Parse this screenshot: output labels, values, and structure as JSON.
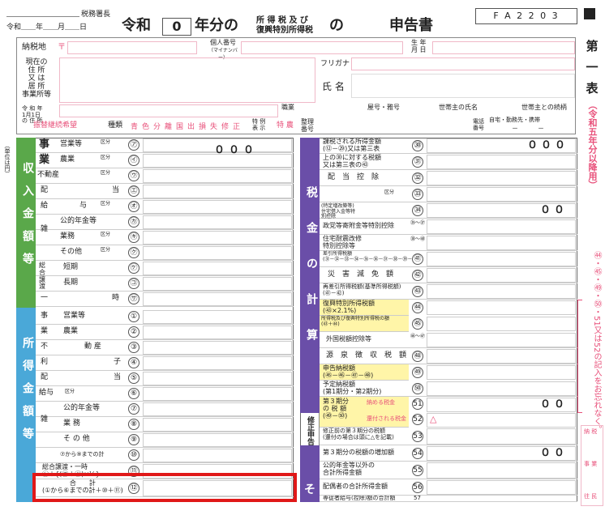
{
  "header": {
    "office_suffix": "税務署長",
    "date_line": "令和＿＿年＿＿月＿＿日",
    "era": "令和",
    "year_box": "0",
    "year_suffix": "年分の",
    "tax_small1": "所 得 税 及 び",
    "tax_small2": "復興特別所得税",
    "no": "の",
    "doc_title": "申告書",
    "form_code": "F A 2 2 0 3"
  },
  "side_title": [
    "第",
    "一",
    "表"
  ],
  "side_note": "（令和五年分以降用）",
  "side_right_note": "㊹・㊺・㊾・㊿・51又は52の記入をお忘れなく。",
  "addr": {
    "nozeichi": "納税地",
    "postal": "〒",
    "kojin_bango": "個人番号",
    "mynumber": "（マイナンバー）",
    "seinengappi": "生 年\n月 日",
    "genzai": "現在の\n住 所\n又 は\n居 所\n事業所等",
    "date_addr": "令 和 年\n1月1日\nの 住 所",
    "furigana": "フリガナ",
    "shimei": "氏 名",
    "shokugyo": "職業",
    "yago": "屋号・雅号",
    "setainushi": "世帯主の氏名",
    "zokugara": "世帯主との続柄",
    "phone_label": "電話\n番号",
    "phone_types": "自宅・勤務先・携帯",
    "phone_dashes": "－　　　－",
    "seiri": "整理\n番号"
  },
  "shurui": {
    "label": "種類",
    "hantei": "振替継続希望",
    "items": [
      "青",
      "色",
      "分",
      "離",
      "国",
      "出",
      "損",
      "失",
      "修",
      "正"
    ],
    "tokurei": "特 農",
    "tokurei_label": "特 例\n表 示"
  },
  "sections": {
    "income": "収入金額等",
    "shotoku": "所得金額等",
    "zei": "税金の計算",
    "shusei": "修正申告",
    "sono": "そ",
    "sideways_unit": "（単位は円）",
    "sideways2": "（単位は円）"
  },
  "income_rows": [
    {
      "cat": "事",
      "sub": "営業等",
      "kubun": "区分",
      "mark": "㋐"
    },
    {
      "cat": "業",
      "sub": "農業",
      "kubun": "区分",
      "mark": "㋑"
    },
    {
      "cat": "不動産",
      "sub": "",
      "kubun": "区分",
      "mark": "㋒"
    },
    {
      "cat": "配",
      "sub": "当",
      "kubun": "",
      "mark": "㋓"
    },
    {
      "cat": "給",
      "sub": "与",
      "kubun": "区分",
      "mark": "㋔"
    },
    {
      "cat": "雑",
      "sub": "公的年金等",
      "kubun": "",
      "mark": "㋕"
    },
    {
      "cat": "",
      "sub": "業務",
      "kubun": "区分",
      "mark": "㋖"
    },
    {
      "cat": "",
      "sub": "その他",
      "kubun": "区分",
      "mark": "㋗"
    },
    {
      "cat": "総合譲渡",
      "sub": "短期",
      "kubun": "",
      "mark": "㋘"
    },
    {
      "cat": "",
      "sub": "長期",
      "kubun": "",
      "mark": "㋙"
    },
    {
      "cat": "一",
      "sub": "時",
      "kubun": "",
      "mark": "㋚"
    }
  ],
  "shotoku_rows": [
    {
      "cat": "事",
      "sub": "営業等",
      "mark": "①"
    },
    {
      "cat": "業",
      "sub": "農業",
      "mark": "②"
    },
    {
      "cat": "不",
      "sub": "動 産",
      "mark": "③"
    },
    {
      "cat": "利",
      "sub": "子",
      "mark": "④"
    },
    {
      "cat": "配",
      "sub": "当",
      "mark": "⑤"
    },
    {
      "cat": "給与",
      "sub": "区分",
      "mark": "⑥"
    },
    {
      "cat": "雑",
      "sub": "公的年金等",
      "mark": "⑦"
    },
    {
      "cat": "",
      "sub": "業 務",
      "mark": "⑧"
    },
    {
      "cat": "",
      "sub": "そ の 他",
      "mark": "⑨"
    },
    {
      "cat": "",
      "sub": "⑦から⑨までの計",
      "mark": "⑩"
    },
    {
      "cat": "",
      "sub": "総合譲渡・一時\n㋘＋{(㋙＋㋚)×½}",
      "mark": "⑪"
    },
    {
      "cat": "",
      "sub": "合　　計\n(①から⑥までの計＋⑩＋⑪)",
      "mark": "⑫"
    }
  ],
  "tax_rows": [
    {
      "label": "課税される所得金額\n(⑫－㉙)又は第三表",
      "mark": "㉚",
      "val": "０００"
    },
    {
      "label": "上の㉚に対する税額\n又は第三表の㊸",
      "mark": "㉛",
      "val": ""
    },
    {
      "label": "配　当　控　除",
      "mark": "㉜",
      "val": ""
    },
    {
      "label": "区分",
      "mark": "㉝",
      "val": ""
    },
    {
      "label": "(特定増改築等)住宅借入金等特別控除",
      "mark": "㉞",
      "val": "００"
    },
    {
      "label": "政党等寄附金等特別控除",
      "mark": "㉟～㊲",
      "val": ""
    },
    {
      "label": "住宅耐震改修\n特別控除等",
      "mark": "㊳～㊵",
      "val": ""
    },
    {
      "label": "差引所得税額\n(㉛－㉜－㉝－㉞－㉟－㊱－㊲－㊳－㊴－㊵)",
      "mark": "㊶",
      "val": ""
    },
    {
      "label": "災　害　減　免　額",
      "mark": "㊷",
      "val": ""
    },
    {
      "label": "再差引所得税額(基準所得税額)\n(㊶－㊷)",
      "mark": "㊸",
      "val": ""
    },
    {
      "label": "復興特別所得税額\n(㊸×2.1%)",
      "mark": "㊹",
      "val": ""
    },
    {
      "label": "所得税及び復興特別所得税の額\n(㊸＋㊹)",
      "mark": "㊺",
      "val": ""
    },
    {
      "label": "外国税額控除等",
      "mark": "㊻～㊼",
      "val": ""
    },
    {
      "label": "源　泉　徴　収　税　額",
      "mark": "㊽",
      "val": ""
    },
    {
      "label": "申告納税額\n(㊺－㊻－㊼－㊽)",
      "mark": "㊾",
      "val": ""
    },
    {
      "label": "予定納税額\n(第1期分・第2期分)",
      "mark": "㊿",
      "val": ""
    },
    {
      "label": "第３期分\nの 税 額\n(㊾－㊿)",
      "mark": "51",
      "val": "００",
      "sub": "納める税金"
    },
    {
      "label": "",
      "mark": "52",
      "val": "△",
      "sub": "還付される税金"
    },
    {
      "label": "修正前の第３期分の税額\n(還付の場合は頭に△を記載)",
      "mark": "53",
      "val": ""
    },
    {
      "label": "第３期分の税額の増加額",
      "mark": "54",
      "val": "００"
    },
    {
      "label": "公的年金等以外の\n合計所得金額",
      "mark": "55",
      "val": ""
    },
    {
      "label": "配偶者の合計所得金額",
      "mark": "56",
      "val": ""
    },
    {
      "label": "専従者給与(控除)額の合計額",
      "mark": "57",
      "val": ""
    }
  ],
  "far_right": [
    "納 税",
    "事 業",
    "往 民"
  ],
  "digits_left": "０００"
}
